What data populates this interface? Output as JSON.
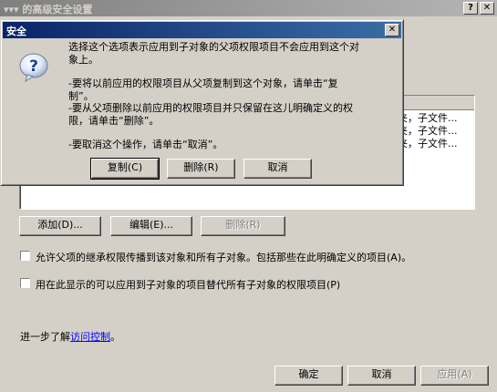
{
  "outer_window": {
    "title": "▾▾▾ 的高级安全设置",
    "help_glyph": "?",
    "close_glyph": "✕",
    "list_rows": [
      {
        "apply_to": "夹，子文件..."
      },
      {
        "apply_to": "夹，子文件..."
      },
      {
        "apply_to": "夹，子文件..."
      }
    ],
    "buttons": {
      "add": "添加(D)...",
      "edit": "编辑(E)...",
      "remove": "删除(R)"
    },
    "inherit_checkbox_label": "允许父项的继承权限传播到该对象和所有子对象。包括那些在此明确定义的项目(A)。",
    "replace_checkbox_label": "用在此显示的可以应用到子对象的项目替代所有子对象的权限项目(P)",
    "learn_more_prefix": "进一步了解",
    "learn_more_link": "访问控制",
    "learn_more_suffix": "。",
    "footer": {
      "ok": "确定",
      "cancel": "取消",
      "apply": "应用(A)"
    }
  },
  "dialog": {
    "title": "安全",
    "close_glyph": "✕",
    "icon": "question-icon",
    "icon_glyph": "?",
    "message": {
      "intro_line1": "选择这个选项表示应用到子对象的父项权限项目不会应用到这个对",
      "intro_line2": "象上。",
      "copy_line1": "-要将以前应用的权限项目从父项复制到这个对象，请单击“复",
      "copy_line2": "制”。",
      "remove_line1": "-要从父项删除以前应用的权限项目并只保留在这儿明确定义的权",
      "remove_line2": "限，请单击“删除”。",
      "cancel_line": "-要取消这个操作，请单击“取消”。"
    },
    "buttons": {
      "copy": "复制(C)",
      "remove": "删除(R)",
      "cancel": "取消"
    }
  }
}
